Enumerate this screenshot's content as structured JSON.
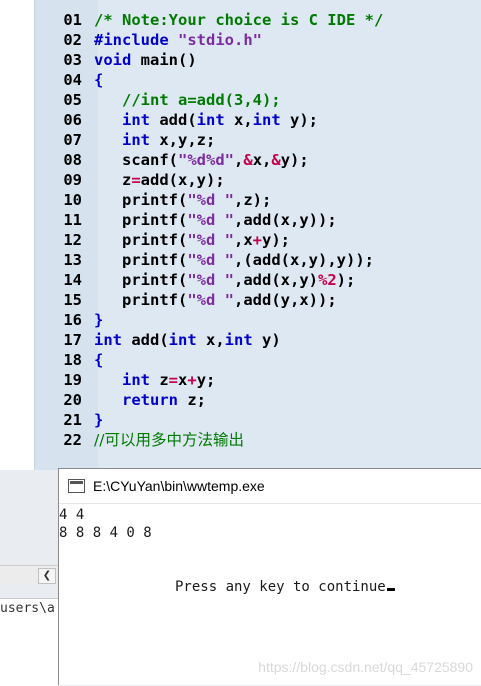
{
  "editor": {
    "lines": [
      {
        "num": "01",
        "tokens": [
          {
            "t": "/* Note:Your choice is C IDE */",
            "c": "cm"
          }
        ]
      },
      {
        "num": "02",
        "tokens": [
          {
            "t": "#include ",
            "c": "kw"
          },
          {
            "t": "\"stdio.h\"",
            "c": "st"
          }
        ]
      },
      {
        "num": "03",
        "tokens": [
          {
            "t": "void",
            "c": "kw"
          },
          {
            "t": " main()",
            "c": "src"
          }
        ]
      },
      {
        "num": "04",
        "tokens": [
          {
            "t": "{",
            "c": "kw"
          }
        ]
      },
      {
        "num": "05",
        "tokens": [
          {
            "t": "   ",
            "c": "src"
          },
          {
            "t": "//int a=add(3,4);",
            "c": "cm"
          }
        ]
      },
      {
        "num": "06",
        "tokens": [
          {
            "t": "   ",
            "c": "src"
          },
          {
            "t": "int",
            "c": "kw"
          },
          {
            "t": " add(",
            "c": "src"
          },
          {
            "t": "int",
            "c": "kw"
          },
          {
            "t": " x,",
            "c": "src"
          },
          {
            "t": "int",
            "c": "kw"
          },
          {
            "t": " y);",
            "c": "src"
          }
        ]
      },
      {
        "num": "07",
        "tokens": [
          {
            "t": "   ",
            "c": "src"
          },
          {
            "t": "int",
            "c": "kw"
          },
          {
            "t": " x,y,z;",
            "c": "src"
          }
        ]
      },
      {
        "num": "08",
        "tokens": [
          {
            "t": "   scanf(",
            "c": "src"
          },
          {
            "t": "\"%d%d\"",
            "c": "st"
          },
          {
            "t": ",",
            "c": "src"
          },
          {
            "t": "&",
            "c": "op"
          },
          {
            "t": "x,",
            "c": "src"
          },
          {
            "t": "&",
            "c": "op"
          },
          {
            "t": "y);",
            "c": "src"
          }
        ]
      },
      {
        "num": "09",
        "tokens": [
          {
            "t": "   z",
            "c": "src"
          },
          {
            "t": "=",
            "c": "op"
          },
          {
            "t": "add(x,y);",
            "c": "src"
          }
        ]
      },
      {
        "num": "10",
        "tokens": [
          {
            "t": "   printf(",
            "c": "src"
          },
          {
            "t": "\"%d \"",
            "c": "st"
          },
          {
            "t": ",z);",
            "c": "src"
          }
        ]
      },
      {
        "num": "11",
        "tokens": [
          {
            "t": "   printf(",
            "c": "src"
          },
          {
            "t": "\"%d \"",
            "c": "st"
          },
          {
            "t": ",add(x,y));",
            "c": "src"
          }
        ]
      },
      {
        "num": "12",
        "tokens": [
          {
            "t": "   printf(",
            "c": "src"
          },
          {
            "t": "\"%d \"",
            "c": "st"
          },
          {
            "t": ",x",
            "c": "src"
          },
          {
            "t": "+",
            "c": "op"
          },
          {
            "t": "y);",
            "c": "src"
          }
        ]
      },
      {
        "num": "13",
        "tokens": [
          {
            "t": "   printf(",
            "c": "src"
          },
          {
            "t": "\"%d \"",
            "c": "st"
          },
          {
            "t": ",(add(x,y),y));",
            "c": "src"
          }
        ]
      },
      {
        "num": "14",
        "tokens": [
          {
            "t": "   printf(",
            "c": "src"
          },
          {
            "t": "\"%d \"",
            "c": "st"
          },
          {
            "t": ",add(x,y)",
            "c": "src"
          },
          {
            "t": "%2",
            "c": "op"
          },
          {
            "t": ");",
            "c": "src"
          }
        ]
      },
      {
        "num": "15",
        "tokens": [
          {
            "t": "   printf(",
            "c": "src"
          },
          {
            "t": "\"%d \"",
            "c": "st"
          },
          {
            "t": ",add(y,x));",
            "c": "src"
          }
        ]
      },
      {
        "num": "16",
        "tokens": [
          {
            "t": "}",
            "c": "kw"
          }
        ]
      },
      {
        "num": "17",
        "tokens": [
          {
            "t": "int",
            "c": "kw"
          },
          {
            "t": " add(",
            "c": "src"
          },
          {
            "t": "int",
            "c": "kw"
          },
          {
            "t": " x,",
            "c": "src"
          },
          {
            "t": "int",
            "c": "kw"
          },
          {
            "t": " y)",
            "c": "src"
          }
        ]
      },
      {
        "num": "18",
        "tokens": [
          {
            "t": "{",
            "c": "kw"
          }
        ]
      },
      {
        "num": "19",
        "tokens": [
          {
            "t": "   ",
            "c": "src"
          },
          {
            "t": "int",
            "c": "kw"
          },
          {
            "t": " z",
            "c": "src"
          },
          {
            "t": "=",
            "c": "op"
          },
          {
            "t": "x",
            "c": "src"
          },
          {
            "t": "+",
            "c": "op"
          },
          {
            "t": "y;",
            "c": "src"
          }
        ]
      },
      {
        "num": "20",
        "tokens": [
          {
            "t": "   ",
            "c": "src"
          },
          {
            "t": "return",
            "c": "kw"
          },
          {
            "t": " z;",
            "c": "src"
          }
        ]
      },
      {
        "num": "21",
        "tokens": [
          {
            "t": "}",
            "c": "kw"
          }
        ]
      },
      {
        "num": "22",
        "tokens": [
          {
            "t": "//可以用多中方法输出",
            "c": "cn"
          }
        ]
      }
    ]
  },
  "left_panel": {
    "path_fragment": "users\\a"
  },
  "console": {
    "title": "E:\\CYuYan\\bin\\wwtemp.exe",
    "output_line1": "4 4",
    "output_line2": "8 8 8 4 0 8",
    "prompt": "Press any key to continue"
  },
  "watermark": "https://blog.csdn.net/qq_45725890",
  "icons": {
    "scroll_left": "chevron-left-icon",
    "console_window": "console-window-icon"
  }
}
